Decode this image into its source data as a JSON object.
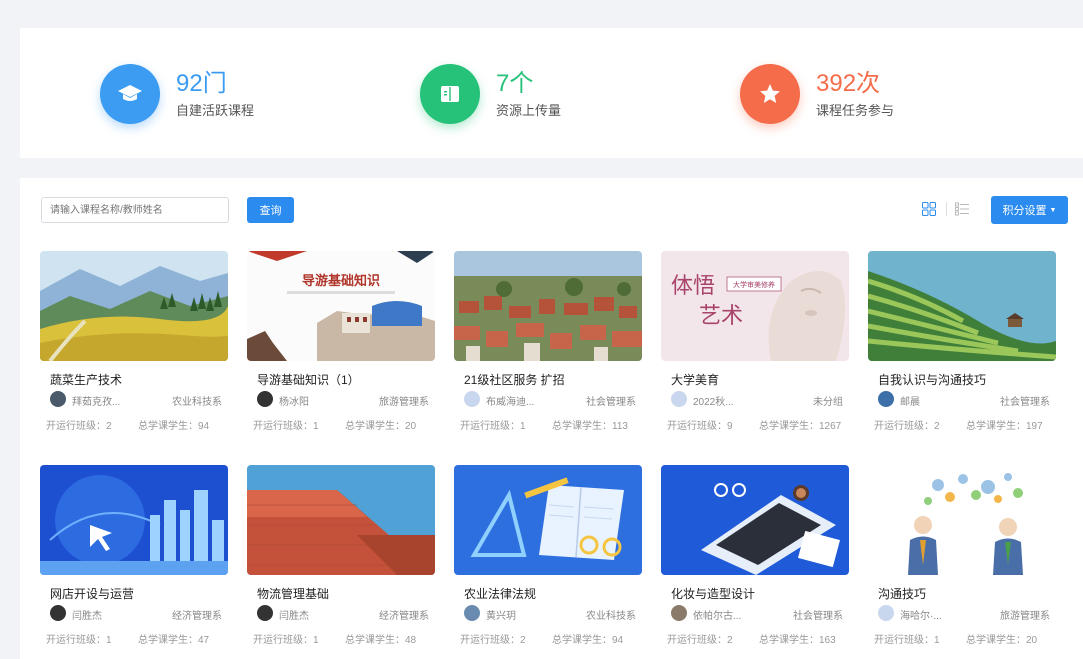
{
  "stats": [
    {
      "value": "92门",
      "label": "自建活跃课程",
      "icon": "graduation-cap-icon",
      "color": "#3b9cf2"
    },
    {
      "value": "7个",
      "label": "资源上传量",
      "icon": "book-icon",
      "color": "#27c27a"
    },
    {
      "value": "392次",
      "label": "课程任务参与",
      "icon": "star-icon",
      "color": "#f56c4a"
    }
  ],
  "toolbar": {
    "search_placeholder": "请输入课程名称/教师姓名",
    "search_button": "查询",
    "settings_button": "积分设置"
  },
  "courses": [
    {
      "title": "蔬菜生产技术",
      "teacher": "拜茹克孜...",
      "dept": "农业科技系",
      "classes": "开运行班级：2",
      "students": "总学课学生：94"
    },
    {
      "title": "导游基础知识（1）",
      "teacher": "杨冰阳",
      "dept": "旅游管理系",
      "classes": "开运行班级：1",
      "students": "总学课学生：20"
    },
    {
      "title": "21级社区服务 扩招",
      "teacher": "布威海迪...",
      "dept": "社会管理系",
      "classes": "开运行班级：1",
      "students": "总学课学生：113"
    },
    {
      "title": "大学美育",
      "teacher": "2022秋...",
      "dept": "未分组",
      "classes": "开运行班级：9",
      "students": "总学课学生：1267"
    },
    {
      "title": "自我认识与沟通技巧",
      "teacher": "邮晨",
      "dept": "社会管理系",
      "classes": "开运行班级：2",
      "students": "总学课学生：197"
    },
    {
      "title": "网店开设与运营",
      "teacher": "闫胜杰",
      "dept": "经济管理系",
      "classes": "开运行班级：1",
      "students": "总学课学生：47"
    },
    {
      "title": "物流管理基础",
      "teacher": "闫胜杰",
      "dept": "经济管理系",
      "classes": "开运行班级：1",
      "students": "总学课学生：48"
    },
    {
      "title": "农业法律法规",
      "teacher": "黄兴玥",
      "dept": "农业科技系",
      "classes": "开运行班级：2",
      "students": "总学课学生：94"
    },
    {
      "title": "化妆与造型设计",
      "teacher": "依帕尔古...",
      "dept": "社会管理系",
      "classes": "开运行班级：2",
      "students": "总学课学生：163"
    },
    {
      "title": "沟通技巧",
      "teacher": "海哈尔·...",
      "dept": "旅游管理系",
      "classes": "开运行班级：1",
      "students": "总学课学生：20"
    }
  ],
  "thumb_texts": {
    "guide_heading": "导游基础知识",
    "art_big1": "体悟",
    "art_big2": "艺术",
    "art_sub": "大学审美修养"
  }
}
